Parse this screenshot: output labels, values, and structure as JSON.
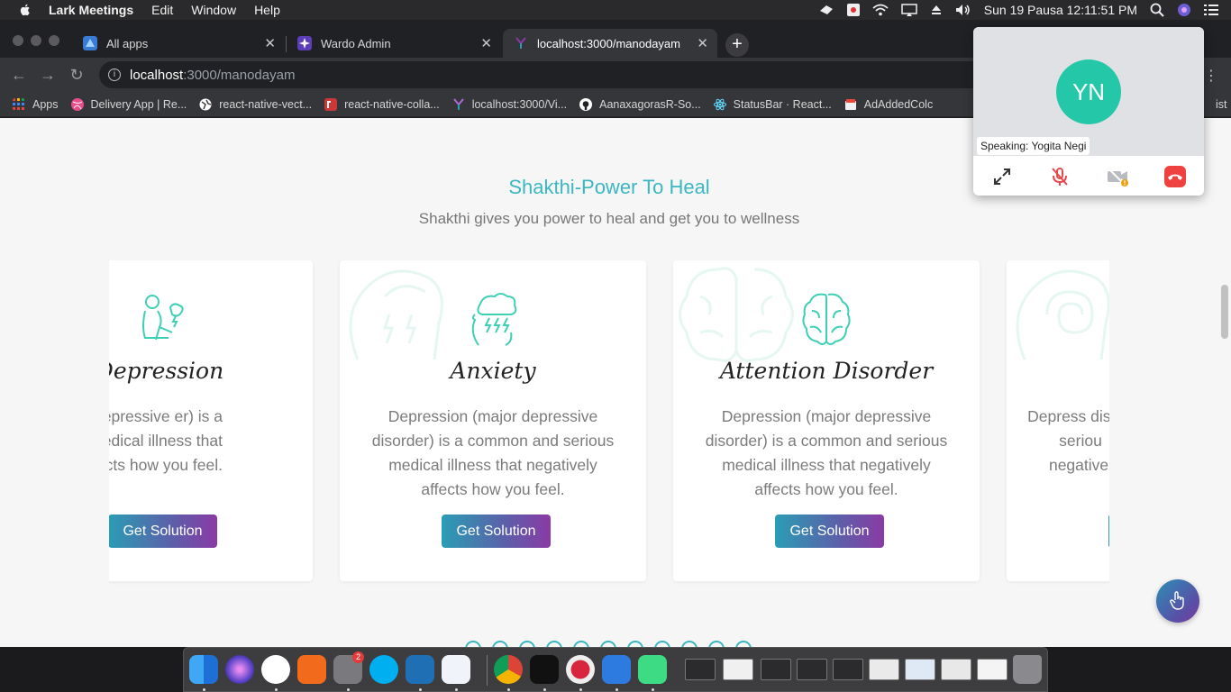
{
  "menubar": {
    "app_name": "Lark Meetings",
    "menus": [
      "Edit",
      "Window",
      "Help"
    ],
    "clock": "Sun 19 Pausa  12:11:51 PM"
  },
  "tabs": [
    {
      "title": "All apps"
    },
    {
      "title": "Wardo Admin"
    },
    {
      "title": "localhost:3000/manodayam",
      "active": true
    }
  ],
  "address": {
    "host": "localhost",
    "path": ":3000/manodayam"
  },
  "bookmarks": [
    {
      "label": "Apps"
    },
    {
      "label": "Delivery App | Re..."
    },
    {
      "label": "react-native-vect..."
    },
    {
      "label": "react-native-colla..."
    },
    {
      "label": "localhost:3000/Vi..."
    },
    {
      "label": "AanaxagorasR-So..."
    },
    {
      "label": "StatusBar · React..."
    },
    {
      "label": "AdAddedColc"
    },
    {
      "label": "ist"
    }
  ],
  "section": {
    "title": "Shakthi-Power To Heal",
    "subtitle": "Shakthi gives you power to heal and get you to wellness"
  },
  "cards": [
    {
      "title": "Depression",
      "description": "sion (major depressive er) is a common and s medical illness that ly affects how you feel.",
      "button": "Get Solution",
      "icon": "depressed-person-icon"
    },
    {
      "title": "Anxiety",
      "description": "Depression (major depressive disorder) is a common and serious medical illness that negatively affects how you feel.",
      "button": "Get Solution",
      "icon": "storm-head-icon"
    },
    {
      "title": "Attention Disorder",
      "description": "Depression (major depressive disorder) is a common and serious medical illness that negatively affects how you feel.",
      "button": "Get Solution",
      "icon": "brain-icon"
    },
    {
      "title": "",
      "description": "Depress disord seriou negativel",
      "button": "",
      "icon": "maze-head-icon"
    }
  ],
  "carousel": {
    "dot_count": 11
  },
  "meeting": {
    "initials": "YN",
    "speaking": "Speaking: Yogita Negi",
    "accent": "#25c7a9"
  },
  "dock": {
    "badge": "2"
  },
  "colors": {
    "accent": "#3bb7c1",
    "button_start": "#2a9db5",
    "button_end": "#8a3aa6"
  }
}
